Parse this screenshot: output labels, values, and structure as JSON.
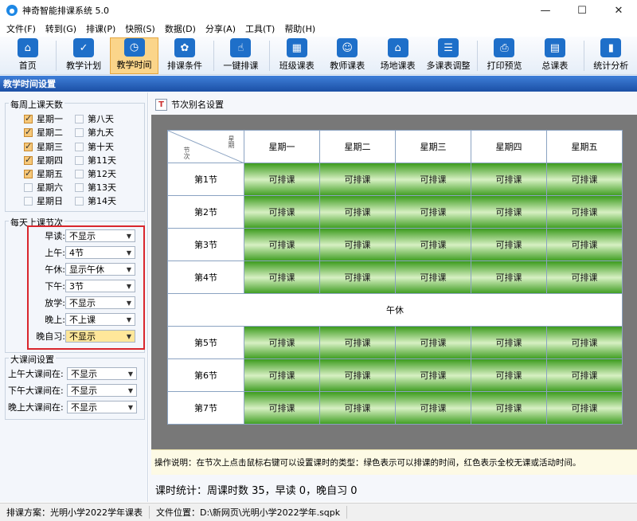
{
  "window": {
    "title": "神奇智能排课系统 5.0",
    "minimize": "—",
    "maximize": "☐",
    "close": "✕"
  },
  "menu": [
    "文件(F)",
    "转到(G)",
    "排课(P)",
    "快照(S)",
    "数据(D)",
    "分享(A)",
    "工具(T)",
    "帮助(H)"
  ],
  "toolbar": [
    {
      "label": "首页",
      "icon": "home-icon",
      "glyph": "⌂"
    },
    {
      "label": "教学计划",
      "icon": "clipboard-icon",
      "glyph": "✓"
    },
    {
      "label": "教学时间",
      "icon": "clock-icon",
      "glyph": "◷",
      "active": true
    },
    {
      "label": "排课条件",
      "icon": "circles-icon",
      "glyph": "✿"
    },
    {
      "label": "一键排课",
      "icon": "hand-click-icon",
      "glyph": "☝"
    },
    {
      "label": "班级课表",
      "icon": "calendar-grid-icon",
      "glyph": "▦"
    },
    {
      "label": "教师课表",
      "icon": "teacher-icon",
      "glyph": "☺"
    },
    {
      "label": "场地课表",
      "icon": "building-icon",
      "glyph": "⌂"
    },
    {
      "label": "多课表调整",
      "icon": "multi-schedule-icon",
      "glyph": "☰"
    },
    {
      "label": "打印预览",
      "icon": "printer-icon",
      "glyph": "⎙"
    },
    {
      "label": "总课表",
      "icon": "calendar-icon",
      "glyph": "▤"
    },
    {
      "label": "统计分析",
      "icon": "bar-chart-icon",
      "glyph": "▮"
    }
  ],
  "section_title": "教学时间设置",
  "left": {
    "days_title": "每周上课天数",
    "days_col1": [
      {
        "label": "星期一",
        "checked": true
      },
      {
        "label": "星期二",
        "checked": true
      },
      {
        "label": "星期三",
        "checked": true
      },
      {
        "label": "星期四",
        "checked": true
      },
      {
        "label": "星期五",
        "checked": true
      },
      {
        "label": "星期六",
        "checked": false
      },
      {
        "label": "星期日",
        "checked": false
      }
    ],
    "days_col2": [
      {
        "label": "第八天",
        "checked": false
      },
      {
        "label": "第九天",
        "checked": false
      },
      {
        "label": "第十天",
        "checked": false
      },
      {
        "label": "第11天",
        "checked": false
      },
      {
        "label": "第12天",
        "checked": false
      },
      {
        "label": "第13天",
        "checked": false
      },
      {
        "label": "第14天",
        "checked": false
      }
    ],
    "periods_title": "每天上课节次",
    "periods": [
      {
        "label": "早读:",
        "value": "不显示"
      },
      {
        "label": "上午:",
        "value": "4节"
      },
      {
        "label": "午休:",
        "value": "显示午休"
      },
      {
        "label": "下午:",
        "value": "3节"
      },
      {
        "label": "放学:",
        "value": "不显示"
      },
      {
        "label": "晚上:",
        "value": "不上课"
      },
      {
        "label": "晚自习:",
        "value": "不显示",
        "highlight": true
      }
    ],
    "breaks_title": "大课间设置",
    "breaks": [
      {
        "label": "上午大课间在:",
        "value": "不显示"
      },
      {
        "label": "下午大课间在:",
        "value": "不显示"
      },
      {
        "label": "晚上大课间在:",
        "value": "不显示"
      }
    ]
  },
  "right": {
    "header_icon": "T",
    "header_label": "节次别名设置",
    "corner_top": "星期",
    "corner_bottom": "节次",
    "days": [
      "星期一",
      "星期二",
      "星期三",
      "星期四",
      "星期五"
    ],
    "morning_rows": [
      "第1节",
      "第2节",
      "第3节",
      "第4节"
    ],
    "noon_label": "午休",
    "afternoon_rows": [
      "第5节",
      "第6节",
      "第7节"
    ],
    "cell_text": "可排课",
    "colors": {
      "ok_green": "#3f9d21",
      "ok_light": "#d7f0c3"
    },
    "note": "操作说明：在节次上点击鼠标右键可以设置课时的类型：绿色表示可以排课的时间，红色表示全校无课或活动时间。",
    "stats": "课时统计：周课时数 35，早读 0，晚自习 0"
  },
  "status": {
    "plan": "排课方案：光明小学2022学年课表",
    "file": "文件位置：D:\\新网页\\光明小学2022学年.sqpk"
  }
}
